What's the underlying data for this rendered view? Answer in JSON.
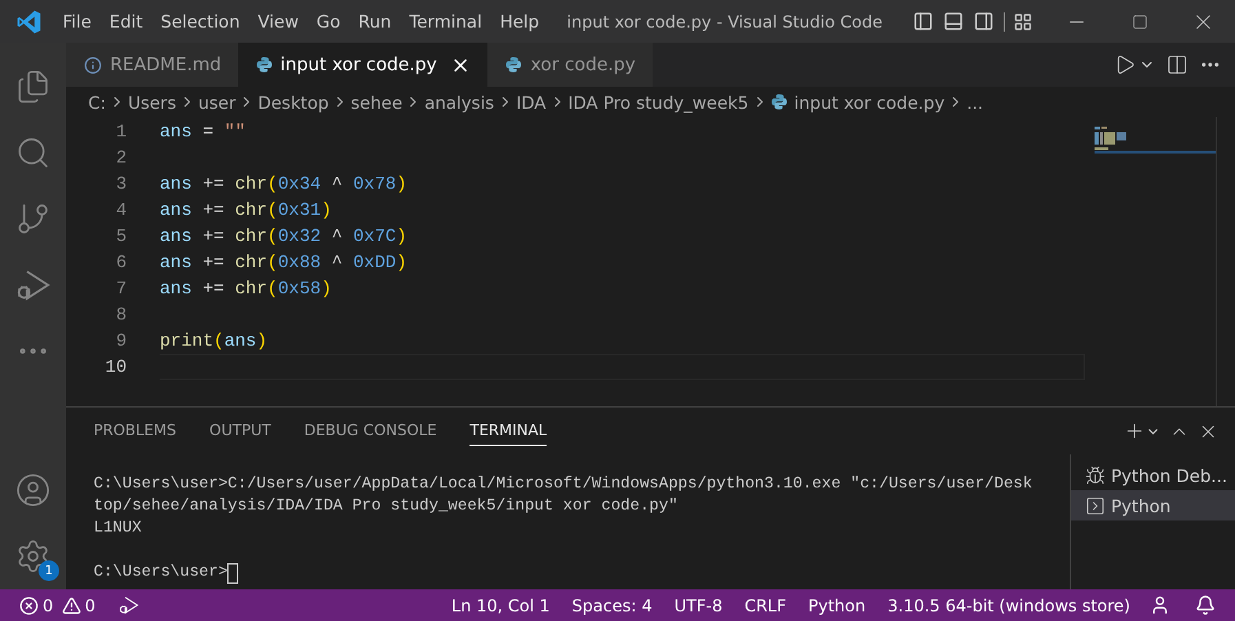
{
  "title_bar": {
    "menu": [
      "File",
      "Edit",
      "Selection",
      "View",
      "Go",
      "Run",
      "Terminal",
      "Help"
    ],
    "title": "input xor code.py - Visual Studio Code"
  },
  "activity_bar": {
    "badge": "1"
  },
  "tabs": [
    {
      "label": "README.md",
      "kind": "info",
      "selected": false
    },
    {
      "label": "input xor code.py",
      "kind": "python",
      "selected": true
    },
    {
      "label": "xor code.py",
      "kind": "python",
      "selected": false
    }
  ],
  "breadcrumb": [
    {
      "label": "C:",
      "kind": "folder"
    },
    {
      "label": "Users",
      "kind": "folder"
    },
    {
      "label": "user",
      "kind": "folder"
    },
    {
      "label": "Desktop",
      "kind": "folder"
    },
    {
      "label": "sehee",
      "kind": "folder"
    },
    {
      "label": "analysis",
      "kind": "folder"
    },
    {
      "label": "IDA",
      "kind": "folder"
    },
    {
      "label": "IDA Pro study_week5",
      "kind": "folder"
    },
    {
      "label": "input xor code.py",
      "kind": "python"
    },
    {
      "label": "...",
      "kind": "folder"
    }
  ],
  "editor": {
    "lines": [
      {
        "number": "1",
        "current": false,
        "tokens": [
          {
            "text": "ans",
            "kind": "var"
          },
          {
            "text": " = ",
            "kind": "op"
          },
          {
            "text": "\"\"",
            "kind": "str"
          }
        ]
      },
      {
        "number": "2",
        "current": false
      },
      {
        "number": "3",
        "current": false,
        "tokens": [
          {
            "text": "ans",
            "kind": "var"
          },
          {
            "text": " += ",
            "kind": "op"
          },
          {
            "text": "chr",
            "kind": "func"
          },
          {
            "text": "(",
            "kind": "paren"
          },
          {
            "text": "0x34",
            "kind": "num"
          },
          {
            "text": " ^ ",
            "kind": "op"
          },
          {
            "text": "0x78",
            "kind": "num"
          },
          {
            "text": ")",
            "kind": "paren"
          }
        ]
      },
      {
        "number": "4",
        "current": false,
        "tokens": [
          {
            "text": "ans",
            "kind": "var"
          },
          {
            "text": " += ",
            "kind": "op"
          },
          {
            "text": "chr",
            "kind": "func"
          },
          {
            "text": "(",
            "kind": "paren"
          },
          {
            "text": "0x31",
            "kind": "num"
          },
          {
            "text": ")",
            "kind": "paren"
          }
        ]
      },
      {
        "number": "5",
        "current": false,
        "tokens": [
          {
            "text": "ans",
            "kind": "var"
          },
          {
            "text": " += ",
            "kind": "op"
          },
          {
            "text": "chr",
            "kind": "func"
          },
          {
            "text": "(",
            "kind": "paren"
          },
          {
            "text": "0x32",
            "kind": "num"
          },
          {
            "text": " ^ ",
            "kind": "op"
          },
          {
            "text": "0x7C",
            "kind": "num"
          },
          {
            "text": ")",
            "kind": "paren"
          }
        ]
      },
      {
        "number": "6",
        "current": false,
        "tokens": [
          {
            "text": "ans",
            "kind": "var"
          },
          {
            "text": " += ",
            "kind": "op"
          },
          {
            "text": "chr",
            "kind": "func"
          },
          {
            "text": "(",
            "kind": "paren"
          },
          {
            "text": "0x88",
            "kind": "num"
          },
          {
            "text": " ^ ",
            "kind": "op"
          },
          {
            "text": "0xDD",
            "kind": "num"
          },
          {
            "text": ")",
            "kind": "paren"
          }
        ]
      },
      {
        "number": "7",
        "current": false,
        "tokens": [
          {
            "text": "ans",
            "kind": "var"
          },
          {
            "text": " += ",
            "kind": "op"
          },
          {
            "text": "chr",
            "kind": "func"
          },
          {
            "text": "(",
            "kind": "paren"
          },
          {
            "text": "0x58",
            "kind": "num"
          },
          {
            "text": ")",
            "kind": "paren"
          }
        ]
      },
      {
        "number": "8",
        "current": false
      },
      {
        "number": "9",
        "current": false,
        "tokens": [
          {
            "text": "print",
            "kind": "func"
          },
          {
            "text": "(",
            "kind": "paren"
          },
          {
            "text": "ans",
            "kind": "var"
          },
          {
            "text": ")",
            "kind": "paren"
          }
        ]
      },
      {
        "number": "10",
        "current": true
      }
    ]
  },
  "panel": {
    "tabs": [
      {
        "label": "PROBLEMS",
        "selected": false
      },
      {
        "label": "OUTPUT",
        "selected": false
      },
      {
        "label": "DEBUG CONSOLE",
        "selected": false
      },
      {
        "label": "TERMINAL",
        "selected": true
      }
    ],
    "terminal": [
      {
        "text": "C:\\Users\\user>C:/Users/user/AppData/Local/Microsoft/WindowsApps/python3.10.exe \"c:/Users/user/Desk",
        "cursor": false
      },
      {
        "text": "top/sehee/analysis/IDA/IDA Pro study_week5/input xor code.py\"",
        "cursor": false
      },
      {
        "text": "L1NUX",
        "cursor": false
      },
      {
        "text": "C:\\Users\\user>",
        "cursor": true
      }
    ],
    "terminals": [
      {
        "label": "Python Deb...",
        "kind": "debug",
        "selected": false
      },
      {
        "label": "Python",
        "kind": "shell",
        "selected": true
      }
    ]
  },
  "status_bar": {
    "errors": "0",
    "warnings": "0",
    "items": [
      "Ln 10, Col 1",
      "Spaces: 4",
      "UTF-8",
      "CRLF",
      "Python",
      "3.10.5 64-bit (windows store)"
    ]
  }
}
